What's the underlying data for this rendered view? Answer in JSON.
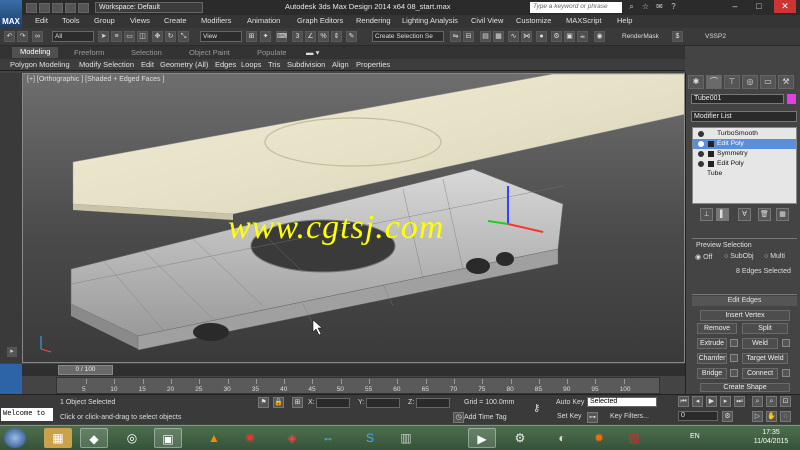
{
  "titlebar": {
    "logo_text": "MAX",
    "workspace": "Workspace: Default",
    "window_title": "Autodesk 3ds Max Design 2014 x64     08_start.max",
    "search_placeholder": "Type a keyword or phrase"
  },
  "menu": [
    "Edit",
    "Tools",
    "Group",
    "Views",
    "Create",
    "Modifiers",
    "Animation",
    "Graph Editors",
    "Rendering",
    "Lighting Analysis",
    "Civil View",
    "Customize",
    "MAXScript",
    "Help"
  ],
  "toolbar": {
    "selection_filter": "All",
    "ref_coord": "View",
    "selection_set": "Create Selection Se",
    "render_mask_label": "RenderMask",
    "vssp_label": "VSSP2"
  },
  "ribbon": {
    "tabs": [
      "Modeling",
      "Freeform",
      "Selection",
      "Object Paint",
      "Populate"
    ],
    "panels": [
      "Polygon Modeling",
      "Modify Selection",
      "Edit",
      "Geometry (All)",
      "Edges",
      "Loops",
      "Tris",
      "Subdivision",
      "Align",
      "Properties"
    ]
  },
  "viewport": {
    "label": "[+] [Orthographic ] [Shaded + Edged Faces ]",
    "watermark": "www.cgtsj.com"
  },
  "command_panel": {
    "object_name": "Tube001",
    "object_color": "#e040e0",
    "modifier_list": "Modifier List",
    "stack": [
      "TurboSmooth",
      "Edit Poly",
      "Symmetry",
      "Edit Poly",
      "Tube"
    ],
    "selected_stack_item": 1,
    "preview_selection": {
      "title": "Preview Selection",
      "off": "Off",
      "subobj": "SubObj",
      "multi": "Multi",
      "status": "8 Edges Selected"
    },
    "edit_edges": {
      "title": "Edit Edges",
      "insert_vertex": "Insert Vertex",
      "remove": "Remove",
      "split": "Split",
      "extrude": "Extrude",
      "weld": "Weld",
      "chamfer": "Chamfer",
      "target_weld": "Target Weld",
      "bridge": "Bridge",
      "connect": "Connect",
      "create_shape": "Create Shape"
    }
  },
  "timeline": {
    "slider": "0 / 100",
    "ticks": [
      "5",
      "10",
      "15",
      "20",
      "25",
      "30",
      "35",
      "40",
      "45",
      "50",
      "55",
      "60",
      "65",
      "70",
      "75",
      "80",
      "85",
      "90",
      "95",
      "100"
    ]
  },
  "status": {
    "welcome": "Welcome to",
    "selected": "1 Object Selected",
    "prompt": "Click or click-and-drag to select objects",
    "x_label": "X:",
    "y_label": "Y:",
    "z_label": "Z:",
    "grid": "Grid = 100.0mm",
    "add_time_tag": "Add Time Tag",
    "auto_key": "Auto Key",
    "set_key": "Set Key",
    "key_mode": "Selected",
    "key_filters": "Key Filters...",
    "frame": "0"
  },
  "taskbar": {
    "lang": "EN",
    "time": "17:35",
    "date": "11/04/2015"
  }
}
